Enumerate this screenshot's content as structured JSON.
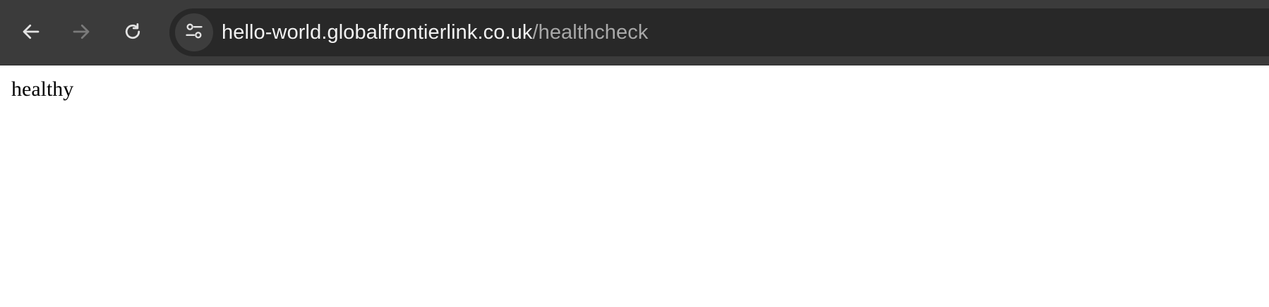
{
  "browser": {
    "nav": {
      "back_icon": "arrow-left-icon",
      "forward_icon": "arrow-right-icon",
      "reload_icon": "reload-icon"
    },
    "address_bar": {
      "site_info_icon": "tune-icon",
      "host": "hello-world.globalfrontierlink.co.uk",
      "path": "/healthcheck"
    }
  },
  "page": {
    "body_text": "healthy"
  },
  "colors": {
    "toolbar_bg": "#3b3b3b",
    "omnibox_bg": "#282828",
    "url_host": "#f2f2f2",
    "url_path": "#a8a8a8",
    "page_bg": "#ffffff"
  }
}
